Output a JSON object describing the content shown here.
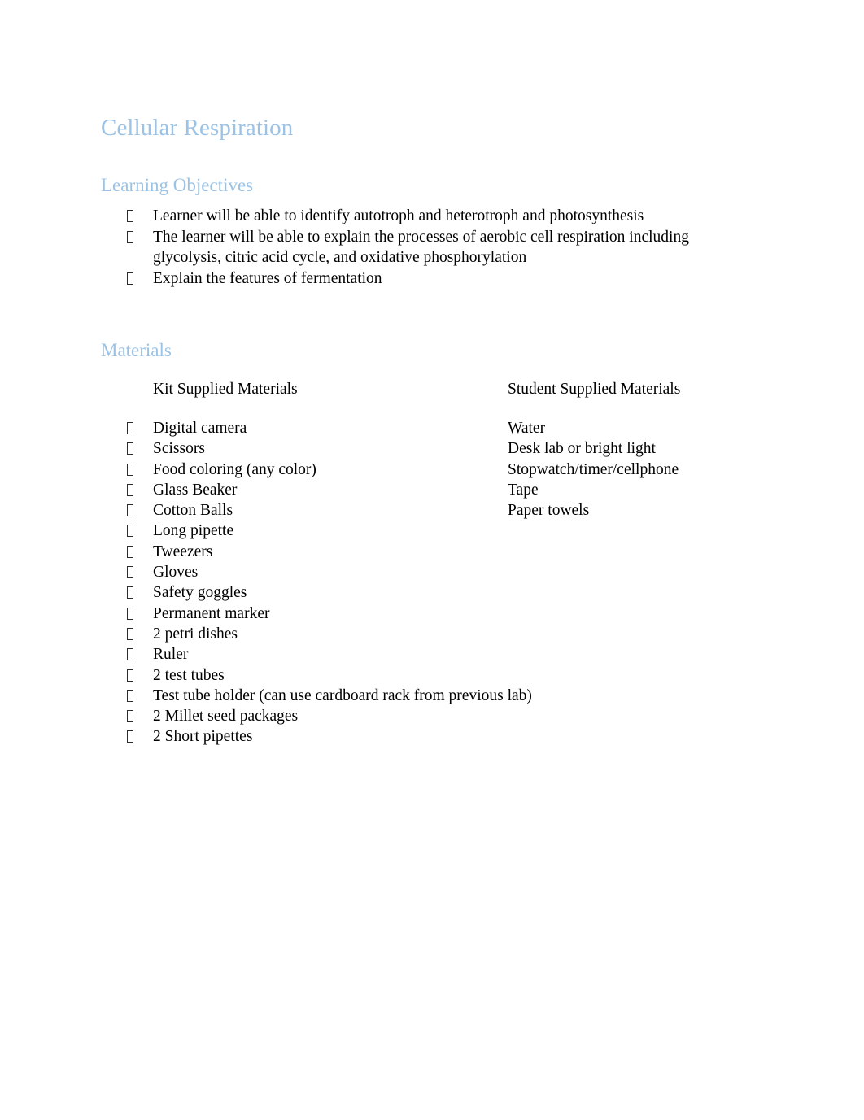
{
  "document": {
    "title": "Cellular Respiration",
    "heading_color": "#9CC3E5",
    "body_color": "#000000",
    "background_color": "#FFFFFF"
  },
  "learning_objectives": {
    "heading": "Learning Objectives",
    "items": [
      "Learner will be able to identify autotroph and heterotroph and photosynthesis",
      "The learner will be able to explain the processes of aerobic cell respiration including glycolysis, citric acid cycle, and oxidative phosphorylation",
      "Explain the features of fermentation"
    ]
  },
  "materials": {
    "heading": "Materials",
    "kit_column_header": "Kit Supplied Materials",
    "student_column_header": "Student Supplied Materials",
    "kit_items": [
      "Digital camera",
      "Scissors",
      "Food coloring (any color)",
      "Glass Beaker",
      "Cotton Balls",
      "Long pipette",
      "Tweezers",
      "Gloves",
      "Safety goggles",
      "Permanent marker",
      "2 petri dishes",
      "Ruler",
      "2 test tubes",
      "Test tube holder (can use cardboard rack from previous lab)",
      "2 Millet seed packages",
      "2 Short pipettes"
    ],
    "student_items": [
      "Water",
      "Desk lab or bright light",
      "Stopwatch/timer/cellphone",
      "Tape",
      "Paper towels"
    ]
  }
}
